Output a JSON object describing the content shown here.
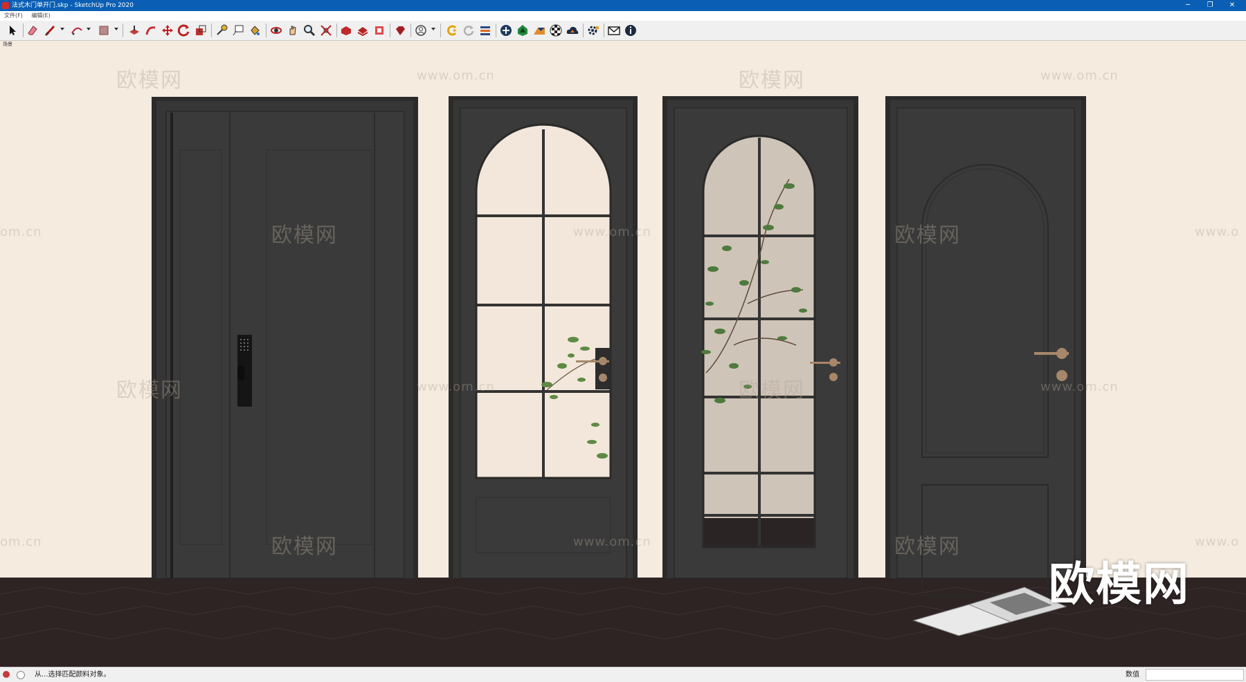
{
  "window": {
    "title": "法式木门单开门.skp - SketchUp Pro 2020",
    "controls": {
      "minimize": "─",
      "maximize": "❐",
      "close": "✕"
    }
  },
  "menu": {
    "items": [
      "文件(F)",
      "编辑(E)"
    ]
  },
  "toolbar": {
    "tools": [
      {
        "name": "select-tool-icon"
      },
      {
        "name": "eraser-tool-icon"
      },
      {
        "name": "line-tool-icon"
      },
      {
        "name": "arc-tool-icon"
      },
      {
        "name": "rectangle-tool-icon"
      },
      {
        "name": "push-pull-tool-icon"
      },
      {
        "name": "follow-me-tool-icon"
      },
      {
        "name": "move-tool-icon"
      },
      {
        "name": "rotate-tool-icon"
      },
      {
        "name": "scale-tool-icon"
      },
      {
        "name": "tape-measure-tool-icon"
      },
      {
        "name": "text-tool-icon"
      },
      {
        "name": "paint-bucket-tool-icon"
      },
      {
        "name": "orbit-tool-icon"
      },
      {
        "name": "pan-tool-icon"
      },
      {
        "name": "zoom-tool-icon"
      },
      {
        "name": "zoom-extents-tool-icon"
      },
      {
        "name": "3d-warehouse-icon"
      },
      {
        "name": "share-model-icon"
      },
      {
        "name": "extension-warehouse-icon"
      },
      {
        "name": "ruby-console-icon"
      },
      {
        "name": "account-icon"
      },
      {
        "name": "sync-icon"
      },
      {
        "name": "refresh-icon"
      },
      {
        "name": "layers-icon"
      },
      {
        "name": "add-location-icon"
      },
      {
        "name": "terrain-icon"
      },
      {
        "name": "sandbox-icon"
      },
      {
        "name": "checker-icon"
      },
      {
        "name": "cloud-upload-icon"
      },
      {
        "name": "settings-icon"
      },
      {
        "name": "mail-icon"
      },
      {
        "name": "info-icon"
      }
    ]
  },
  "viewport": {
    "scene_label": "场景",
    "watermarks": {
      "cn": "欧模网",
      "url": "www.om.cn",
      "edge_left": "om.cn",
      "edge_right": "www.o"
    },
    "logo": "欧模网"
  },
  "statusbar": {
    "message": "从...选择匹配颜料对象。",
    "measurement_label": "数值",
    "measurement_value": ""
  }
}
